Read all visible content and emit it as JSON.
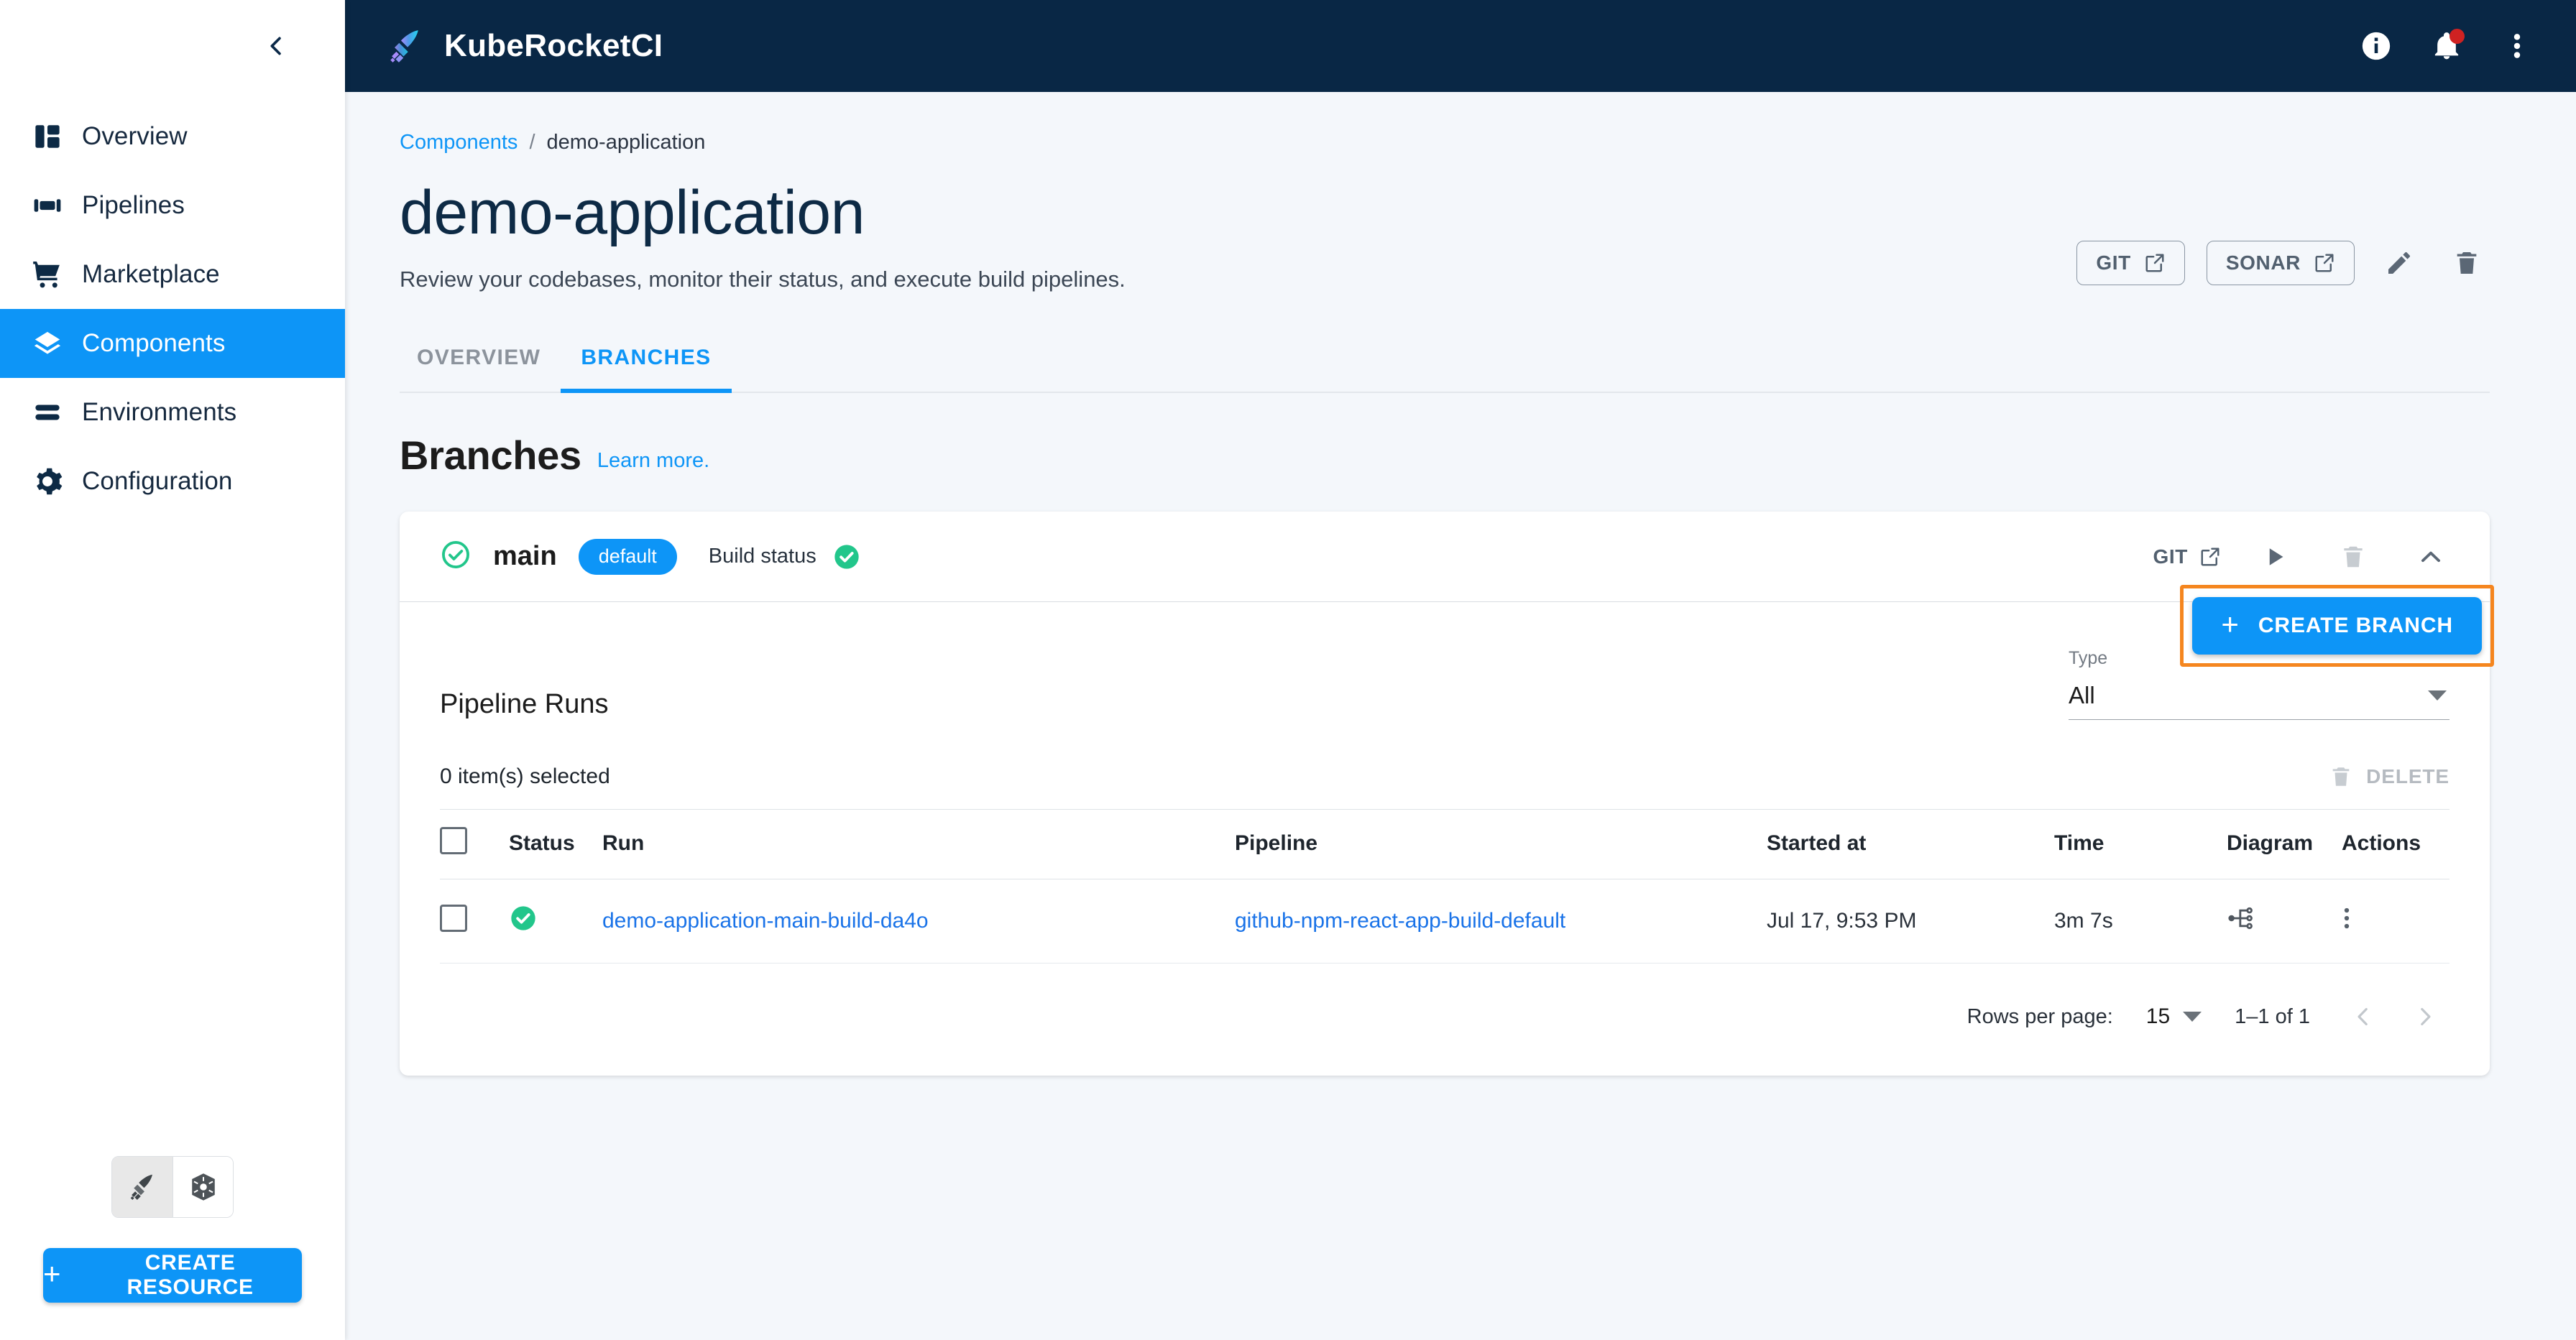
{
  "topbar": {
    "brand": "KubeRocketCI",
    "icons": [
      {
        "name": "info-icon",
        "label": "Info"
      },
      {
        "name": "notifications-icon",
        "label": "Notifications"
      },
      {
        "name": "more-vertical-icon",
        "label": "More"
      }
    ]
  },
  "sidebar": {
    "collapse_label": "Collapse",
    "items": [
      {
        "label": "Overview",
        "icon": "dashboard-icon",
        "active": false
      },
      {
        "label": "Pipelines",
        "icon": "pipelines-icon",
        "active": false
      },
      {
        "label": "Marketplace",
        "icon": "cart-icon",
        "active": false
      },
      {
        "label": "Components",
        "icon": "layers-icon",
        "active": true
      },
      {
        "label": "Environments",
        "icon": "environments-icon",
        "active": false
      },
      {
        "label": "Configuration",
        "icon": "gear-icon",
        "active": false
      }
    ],
    "env_toggle": [
      {
        "name": "kuberocket-icon",
        "selected": true
      },
      {
        "name": "kubernetes-icon",
        "selected": false
      }
    ],
    "create_resource_label": "CREATE RESOURCE"
  },
  "breadcrumb": {
    "parent": "Components",
    "separator": "/",
    "current": "demo-application"
  },
  "header_actions": {
    "git_label": "GIT",
    "sonar_label": "SONAR",
    "edit_label": "Edit",
    "delete_label": "Delete"
  },
  "page": {
    "title": "demo-application",
    "subtitle": "Review your codebases, monitor their status, and execute build pipelines."
  },
  "tabs": [
    {
      "label": "OVERVIEW",
      "active": false
    },
    {
      "label": "BRANCHES",
      "active": true
    }
  ],
  "branches_section": {
    "title": "Branches",
    "learn_more": "Learn more.",
    "create_branch_label": "CREATE BRANCH",
    "highlight_color": "#f5861f"
  },
  "branch": {
    "status_icon": "check-circle-outline-icon",
    "name": "main",
    "chip": "default",
    "build_status_label": "Build status",
    "build_status_icon": "check-circle-filled-icon",
    "git_label": "GIT",
    "run_label": "Run",
    "delete_label": "Delete",
    "collapse_label": "Collapse"
  },
  "runs": {
    "title": "Pipeline Runs",
    "type_filter": {
      "label": "Type",
      "value": "All"
    },
    "selected_text": "0 item(s) selected",
    "delete_label": "DELETE",
    "columns": [
      "Status",
      "Run",
      "Pipeline",
      "Started at",
      "Time",
      "Diagram",
      "Actions"
    ],
    "rows": [
      {
        "status": "succeeded",
        "run": "demo-application-main-build-da4o",
        "pipeline": "github-npm-react-app-build-default",
        "started_at": "Jul 17, 9:53 PM",
        "time": "3m 7s",
        "diagram_icon": "diagram-icon",
        "actions_icon": "more-vertical-icon"
      }
    ],
    "pagination": {
      "rows_per_page_label": "Rows per page:",
      "rows_per_page_value": "15",
      "range": "1–1 of 1",
      "prev_label": "Previous page",
      "next_label": "Next page"
    }
  },
  "colors": {
    "accent": "#0d95f7",
    "navy": "#092745",
    "success": "#22c68b",
    "highlight": "#f5861f",
    "page_bg": "#f4f7fb"
  }
}
